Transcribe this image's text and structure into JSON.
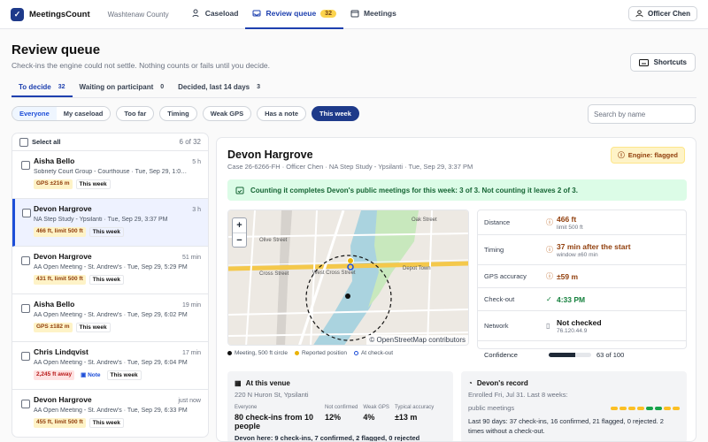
{
  "app": {
    "name": "MeetingsCount",
    "county": "Washtenaw County"
  },
  "nav": {
    "caseload": "Caseload",
    "review": "Review queue",
    "review_count": "32",
    "meetings": "Meetings",
    "officer": "Officer Chen"
  },
  "page": {
    "title": "Review queue",
    "subtitle": "Check-ins the engine could not settle. Nothing counts or fails until you decide.",
    "shortcuts": "Shortcuts"
  },
  "tabs": [
    {
      "label": "To decide",
      "count": "32"
    },
    {
      "label": "Waiting on participant",
      "count": "0"
    },
    {
      "label": "Decided, last 14 days",
      "count": "3"
    }
  ],
  "filters": {
    "everyone": "Everyone",
    "mine": "My caseload",
    "chips": [
      "Too far",
      "Timing",
      "Weak GPS",
      "Has a note"
    ],
    "week": "This week",
    "search_placeholder": "Search by name"
  },
  "list": {
    "select_all": "Select all",
    "count": "6 of 32",
    "items": [
      {
        "name": "Aisha Bello",
        "when": "5 h",
        "desc": "Sobriety Court Group - Courthouse · Tue, Sep 29, 1:0…",
        "tag1": "GPS ±216 m",
        "tag2": "This week"
      },
      {
        "name": "Devon Hargrove",
        "when": "3 h",
        "desc": "NA Step Study - Ypsilanti · Tue, Sep 29, 3:37 PM",
        "tag1": "466 ft, limit 500 ft",
        "tag2": "This week"
      },
      {
        "name": "Devon Hargrove",
        "when": "51 min",
        "desc": "AA Open Meeting - St. Andrew's · Tue, Sep 29, 5:29 PM",
        "tag1": "431 ft, limit 500 ft",
        "tag2": "This week"
      },
      {
        "name": "Aisha Bello",
        "when": "19 min",
        "desc": "AA Open Meeting - St. Andrew's · Tue, Sep 29, 6:02 PM",
        "tag1": "GPS ±182 m",
        "tag2": "This week"
      },
      {
        "name": "Chris Lindqvist",
        "when": "17 min",
        "desc": "AA Open Meeting - St. Andrew's · Tue, Sep 29, 6:04 PM",
        "tag1": "2,245 ft away",
        "tag_note": "Note",
        "tag2": "This week"
      },
      {
        "name": "Devon Hargrove",
        "when": "just now",
        "desc": "AA Open Meeting - St. Andrew's · Tue, Sep 29, 6:33 PM",
        "tag1": "455 ft, limit 500 ft",
        "tag2": "This week"
      }
    ]
  },
  "detail": {
    "name": "Devon Hargrove",
    "case": "Case 26-6266-FH · Officer Chen · NA Step Study - Ypsilanti · Tue, Sep 29, 3:37 PM",
    "engine": "Engine: flagged",
    "banner": "Counting it completes Devon's public meetings for this week: 3 of 3. Not counting it leaves 2 of 3.",
    "map_attr": "© OpenStreetMap contributors",
    "legend": {
      "meeting": "Meeting, 500 ft circle",
      "reported": "Reported position",
      "checkout": "At check-out"
    },
    "factors": {
      "distance_k": "Distance",
      "distance_v": "466 ft",
      "distance_s": "limit 500 ft",
      "timing_k": "Timing",
      "timing_v": "37 min after the start",
      "timing_s": "window ±60 min",
      "gps_k": "GPS accuracy",
      "gps_v": "±59 m",
      "checkout_k": "Check-out",
      "checkout_v": "4:33 PM",
      "network_k": "Network",
      "network_v": "Not checked",
      "network_s": "76.120.44.9",
      "conf_k": "Confidence",
      "conf_v": "63 of 100",
      "conf_value": 0.63
    },
    "venue": {
      "title": "At this venue",
      "address": "220 N Huron St, Ypsilanti",
      "everyone_l": "Everyone",
      "everyone_v": "80 check-ins from 10 people",
      "nc_l": "Not confirmed",
      "nc_v": "12%",
      "wg_l": "Weak GPS",
      "wg_v": "4%",
      "ta_l": "Typical accuracy",
      "ta_v": "±13 m",
      "more": "Devon here: 9 check-ins, 7 confirmed, 2 flagged, 0 rejected"
    },
    "record": {
      "title": "Devon's record",
      "enrolled": "Enrolled Fri, Jul 31. Last 8 weeks:",
      "pm": "public meetings",
      "last90": "Last 90 days: 37 check-ins, 16 confirmed, 21 flagged, 0 rejected. 2 times without a check-out."
    }
  }
}
